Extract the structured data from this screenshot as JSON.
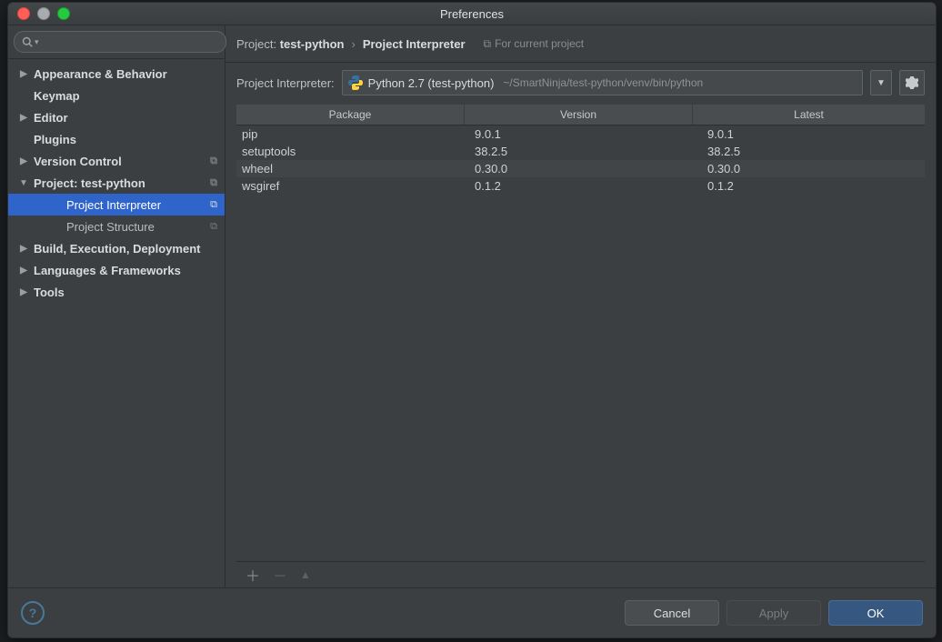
{
  "window": {
    "title": "Preferences"
  },
  "sidebar": {
    "search_placeholder": "",
    "items": [
      {
        "label": "Appearance & Behavior",
        "bold": true,
        "arrow": "right"
      },
      {
        "label": "Keymap",
        "bold": true,
        "arrow": ""
      },
      {
        "label": "Editor",
        "bold": true,
        "arrow": "right"
      },
      {
        "label": "Plugins",
        "bold": true,
        "arrow": ""
      },
      {
        "label": "Version Control",
        "bold": true,
        "arrow": "right",
        "badge": true
      },
      {
        "label": "Project: test-python",
        "bold": true,
        "arrow": "down",
        "badge": true
      },
      {
        "label": "Project Interpreter",
        "indent": 2,
        "selected": true,
        "badge": true
      },
      {
        "label": "Project Structure",
        "indent": 2,
        "badge": true
      },
      {
        "label": "Build, Execution, Deployment",
        "bold": true,
        "arrow": "right"
      },
      {
        "label": "Languages & Frameworks",
        "bold": true,
        "arrow": "right"
      },
      {
        "label": "Tools",
        "bold": true,
        "arrow": "right"
      }
    ]
  },
  "breadcrumb": {
    "prefix": "Project: ",
    "project": "test-python",
    "page": "Project Interpreter",
    "note": "For current project"
  },
  "interpreter": {
    "label": "Project Interpreter:",
    "name": "Python 2.7 (test-python)",
    "path": "~/SmartNinja/test-python/venv/bin/python"
  },
  "table": {
    "columns": {
      "pkg": "Package",
      "ver": "Version",
      "lat": "Latest"
    },
    "rows": [
      {
        "pkg": "pip",
        "ver": "9.0.1",
        "lat": "9.0.1"
      },
      {
        "pkg": "setuptools",
        "ver": "38.2.5",
        "lat": "38.2.5"
      },
      {
        "pkg": "wheel",
        "ver": "0.30.0",
        "lat": "0.30.0",
        "selected": true
      },
      {
        "pkg": "wsgiref",
        "ver": "0.1.2",
        "lat": "0.1.2"
      }
    ]
  },
  "footer": {
    "cancel": "Cancel",
    "apply": "Apply",
    "ok": "OK"
  }
}
